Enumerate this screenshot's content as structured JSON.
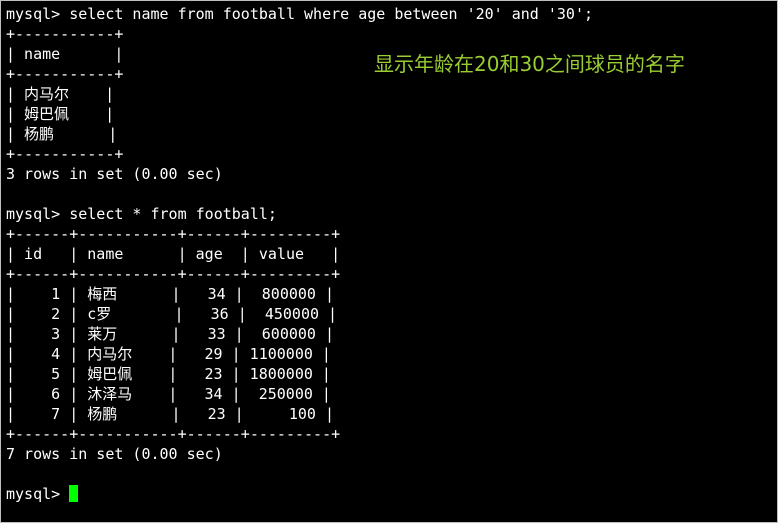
{
  "terminal": {
    "lines": [
      "mysql> select name from football where age between '20' and '30';",
      "+-----------+",
      "| name      |",
      "+-----------+",
      "| 内马尔    |",
      "| 姆巴佩    |",
      "| 杨鹏      |",
      "+-----------+",
      "3 rows in set (0.00 sec)",
      "",
      "mysql> select * from football;",
      "+------+-----------+------+---------+",
      "| id   | name      | age  | value   |",
      "+------+-----------+------+---------+",
      "|    1 | 梅西      |   34 |  800000 |",
      "|    2 | c罗       |   36 |  450000 |",
      "|    3 | 莱万      |   33 |  600000 |",
      "|    4 | 内马尔    |   29 | 1100000 |",
      "|    5 | 姆巴佩    |   23 | 1800000 |",
      "|    6 | 沐泽马    |   34 |  250000 |",
      "|    7 | 杨鹏      |   23 |     100 |",
      "+------+-----------+------+---------+",
      "7 rows in set (0.00 sec)",
      "",
      "mysql> "
    ],
    "foreground": "#ffffff",
    "background": "#000000",
    "cursor_color": "#00ff00"
  },
  "annotation": {
    "text": "显示年龄在20和30之间球员的名字",
    "color": "#9acd32"
  }
}
